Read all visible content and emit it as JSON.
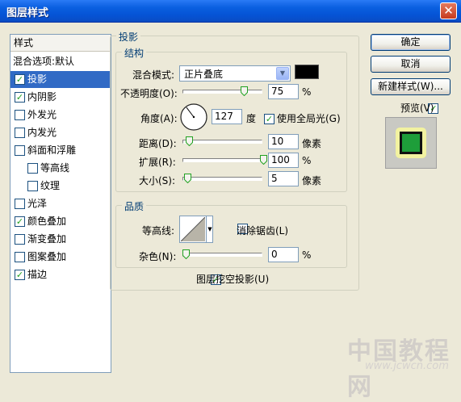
{
  "window": {
    "title": "图层样式",
    "close_glyph": "✕"
  },
  "left_panel": {
    "header": "样式",
    "items": [
      {
        "label": "混合选项:默认",
        "checkbox": false,
        "indent": 0
      },
      {
        "label": "投影",
        "checkbox": true,
        "checked": true,
        "selected": true,
        "indent": 0
      },
      {
        "label": "内阴影",
        "checkbox": true,
        "checked": true,
        "indent": 0
      },
      {
        "label": "外发光",
        "checkbox": true,
        "checked": false,
        "indent": 0
      },
      {
        "label": "内发光",
        "checkbox": true,
        "checked": false,
        "indent": 0
      },
      {
        "label": "斜面和浮雕",
        "checkbox": true,
        "checked": false,
        "indent": 0
      },
      {
        "label": "等高线",
        "checkbox": true,
        "checked": false,
        "indent": 1
      },
      {
        "label": "纹理",
        "checkbox": true,
        "checked": false,
        "indent": 1
      },
      {
        "label": "光泽",
        "checkbox": true,
        "checked": false,
        "indent": 0
      },
      {
        "label": "颜色叠加",
        "checkbox": true,
        "checked": true,
        "indent": 0
      },
      {
        "label": "渐变叠加",
        "checkbox": true,
        "checked": false,
        "indent": 0
      },
      {
        "label": "图案叠加",
        "checkbox": true,
        "checked": false,
        "indent": 0
      },
      {
        "label": "描边",
        "checkbox": true,
        "checked": true,
        "indent": 0
      }
    ]
  },
  "drop_shadow": {
    "title": "投影",
    "structure": {
      "title": "结构",
      "blend_mode_label": "混合模式:",
      "blend_mode_value": "正片叠底",
      "shadow_color": "#000000",
      "opacity_label": "不透明度(O):",
      "opacity_value": "75",
      "opacity_unit": "%",
      "opacity_level": 0.75,
      "angle_label": "角度(A):",
      "angle_value": "127",
      "angle_unit": "度",
      "use_global_light_label": "使用全局光(G)",
      "use_global_light_checked": true,
      "distance_label": "距离(D):",
      "distance_value": "10",
      "distance_unit": "像素",
      "distance_level": 0.04,
      "spread_label": "扩展(R):",
      "spread_value": "100",
      "spread_unit": "%",
      "spread_level": 1.0,
      "size_label": "大小(S):",
      "size_value": "5",
      "size_unit": "像素",
      "size_level": 0.02
    },
    "quality": {
      "title": "品质",
      "contour_label": "等高线:",
      "anti_alias_label": "消除锯齿(L)",
      "anti_alias_checked": false,
      "noise_label": "杂色(N):",
      "noise_value": "0",
      "noise_unit": "%",
      "noise_level": 0.0
    },
    "knockout_label": "图层挖空投影(U)",
    "knockout_checked": true
  },
  "buttons": {
    "ok": "确定",
    "cancel": "取消",
    "new_style": "新建样式(W)...",
    "preview_label": "预览(V)",
    "preview_checked": true
  },
  "preview": {
    "fill_color": "#1E9E3A",
    "border_color": "#111111",
    "glow_color": "#F2F2A0"
  },
  "watermark": {
    "text": "中国教程网",
    "url": "www.jcwcn.com"
  }
}
